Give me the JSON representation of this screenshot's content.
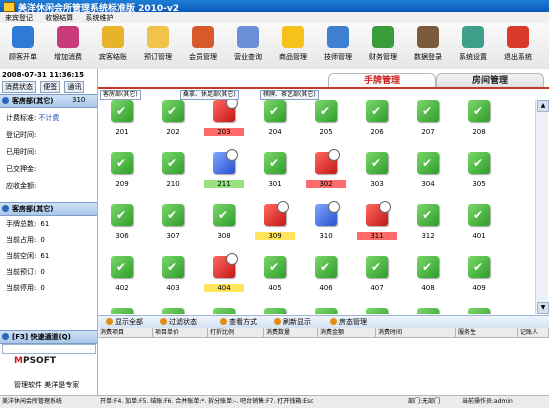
{
  "window": {
    "title": "美洋休闲会所管理系统标准版 2010-v2"
  },
  "menu": [
    "来宾登记",
    "收银结算",
    "系统维护"
  ],
  "toolbar": [
    {
      "label": "顾客开单",
      "icon": "customer-order-icon",
      "color": "#2f7ad6"
    },
    {
      "label": "增加消费",
      "icon": "add-consume-icon",
      "color": "#c73b7a"
    },
    {
      "label": "宾客结账",
      "icon": "checkout-icon",
      "color": "#e7b32a"
    },
    {
      "label": "预订管理",
      "icon": "reservation-icon",
      "color": "#f0c34a"
    },
    {
      "label": "会员管理",
      "icon": "member-icon",
      "color": "#d85a2a"
    },
    {
      "label": "营业查询",
      "icon": "business-query-icon",
      "color": "#6a8fd6"
    },
    {
      "label": "商品管理",
      "icon": "goods-icon",
      "color": "#f4c21a"
    },
    {
      "label": "技师管理",
      "icon": "technician-icon",
      "color": "#3d7fd0"
    },
    {
      "label": "财务管理",
      "icon": "finance-icon",
      "color": "#3a9c3a"
    },
    {
      "label": "数据登录",
      "icon": "data-login-icon",
      "color": "#7a5a3a"
    },
    {
      "label": "系统设置",
      "icon": "settings-icon",
      "color": "#3ea08a"
    },
    {
      "label": "退出系统",
      "icon": "exit-icon",
      "color": "#d93a2a"
    }
  ],
  "left": {
    "datetime": "2008-07-31  11:36:15",
    "tabs": [
      "消费状态",
      "便签",
      "通讯"
    ],
    "room_section": {
      "title": "客房部(其它)",
      "count": "310"
    },
    "room_fields": [
      {
        "k": "计费标准:",
        "v": "不计费"
      },
      {
        "k": "登记时间:",
        "v": ""
      },
      {
        "k": "已用时间:",
        "v": ""
      },
      {
        "k": "已交押金:",
        "v": ""
      },
      {
        "k": "应收金额:",
        "v": ""
      }
    ],
    "stats_section": {
      "title": "客房部(其它)"
    },
    "stats": [
      {
        "k": "手牌总数:",
        "v": "61"
      },
      {
        "k": "当前占用:",
        "v": "0"
      },
      {
        "k": "当前空闲:",
        "v": "61"
      },
      {
        "k": "当前预订:",
        "v": "0"
      },
      {
        "k": "当前停用:",
        "v": "0"
      }
    ],
    "quick": {
      "title": "[F3] 快速通道(Q)"
    },
    "logo": {
      "text_a": "M",
      "text_b": "PSOFT"
    },
    "slogan": "管理软件  美洋是专家"
  },
  "main": {
    "tabs": [
      "手牌管理",
      "房间管理"
    ],
    "subtabs": [
      "客房部(其它)",
      "桑拿、休足部(其它)",
      "棋牌、茶艺部(其它)"
    ],
    "rooms": [
      {
        "n": "201",
        "s": "green",
        "h": ""
      },
      {
        "n": "202",
        "s": "green",
        "h": ""
      },
      {
        "n": "203",
        "s": "red",
        "h": "red"
      },
      {
        "n": "204",
        "s": "green",
        "h": ""
      },
      {
        "n": "205",
        "s": "green",
        "h": ""
      },
      {
        "n": "206",
        "s": "green",
        "h": ""
      },
      {
        "n": "207",
        "s": "green",
        "h": ""
      },
      {
        "n": "208",
        "s": "green",
        "h": ""
      },
      {
        "n": "209",
        "s": "green",
        "h": ""
      },
      {
        "n": "210",
        "s": "green",
        "h": ""
      },
      {
        "n": "211",
        "s": "blue",
        "h": "green"
      },
      {
        "n": "301",
        "s": "green",
        "h": ""
      },
      {
        "n": "302",
        "s": "red",
        "h": "red"
      },
      {
        "n": "303",
        "s": "green",
        "h": ""
      },
      {
        "n": "304",
        "s": "green",
        "h": ""
      },
      {
        "n": "305",
        "s": "green",
        "h": ""
      },
      {
        "n": "306",
        "s": "green",
        "h": ""
      },
      {
        "n": "307",
        "s": "green",
        "h": ""
      },
      {
        "n": "308",
        "s": "green",
        "h": ""
      },
      {
        "n": "309",
        "s": "red",
        "h": "yellow"
      },
      {
        "n": "310",
        "s": "blue",
        "h": ""
      },
      {
        "n": "311",
        "s": "red",
        "h": "red"
      },
      {
        "n": "312",
        "s": "green",
        "h": ""
      },
      {
        "n": "401",
        "s": "green",
        "h": ""
      },
      {
        "n": "402",
        "s": "green",
        "h": ""
      },
      {
        "n": "403",
        "s": "green",
        "h": ""
      },
      {
        "n": "404",
        "s": "red",
        "h": "yellow"
      },
      {
        "n": "405",
        "s": "green",
        "h": ""
      },
      {
        "n": "406",
        "s": "green",
        "h": ""
      },
      {
        "n": "407",
        "s": "green",
        "h": ""
      },
      {
        "n": "408",
        "s": "green",
        "h": ""
      },
      {
        "n": "409",
        "s": "green",
        "h": ""
      },
      {
        "n": "",
        "s": "green",
        "h": ""
      },
      {
        "n": "",
        "s": "green",
        "h": ""
      },
      {
        "n": "",
        "s": "green",
        "h": ""
      },
      {
        "n": "",
        "s": "green",
        "h": ""
      },
      {
        "n": "",
        "s": "green",
        "h": ""
      },
      {
        "n": "",
        "s": "green",
        "h": ""
      },
      {
        "n": "",
        "s": "green",
        "h": ""
      },
      {
        "n": "",
        "s": "green",
        "h": ""
      }
    ],
    "actions": [
      "显示全部",
      "过滤状态",
      "查看方式",
      "刷新显示",
      "房态管理"
    ],
    "table_cols": [
      "消费项目",
      "项目单价",
      "打折比例",
      "消费数量",
      "消费金额",
      "消费时间",
      "服务生",
      "记账人"
    ]
  },
  "status": {
    "left": "美洋休闲会所管理系统",
    "keys": "开单:F4. 加单:F5. 结账:F6. 合并账单:*. 拆分账单:-. 吧台销售:F7. 打开钱箱:Esc",
    "dept": "部门:无部门",
    "user": "当前操作员:admin"
  }
}
